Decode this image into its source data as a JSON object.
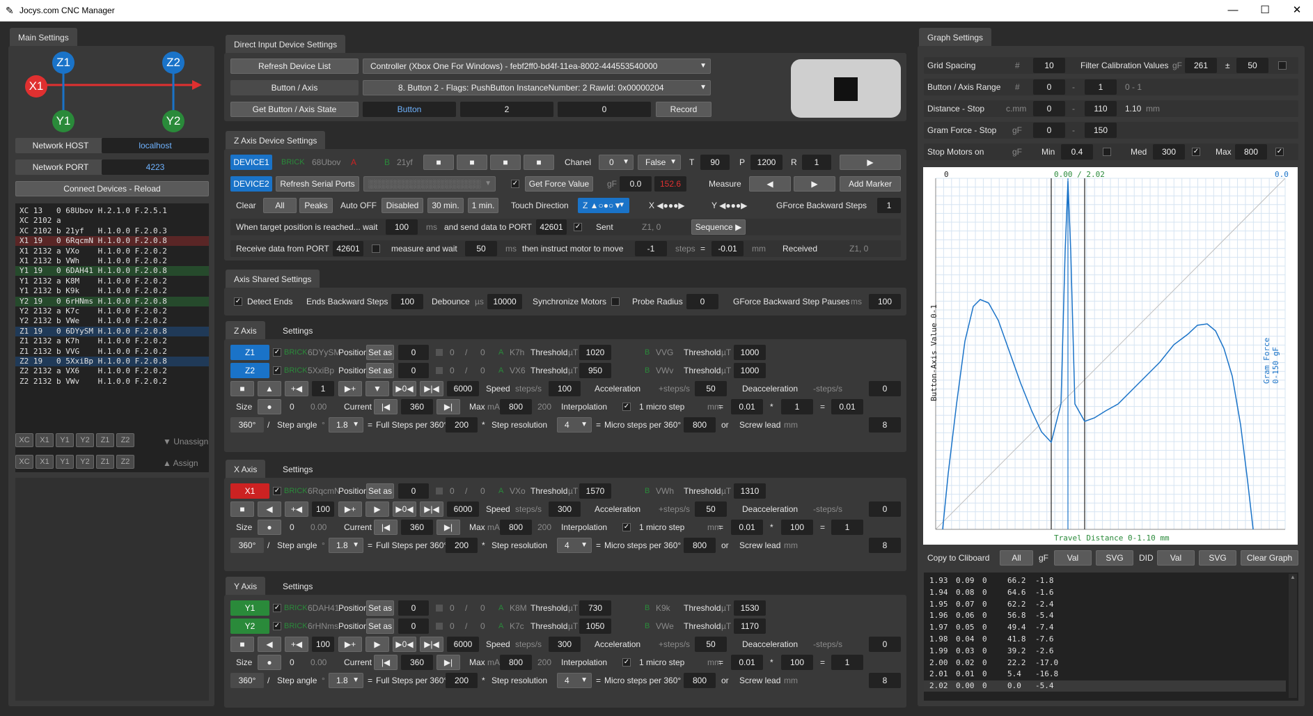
{
  "window": {
    "title": "Jocys.com CNC Manager",
    "icon": "pencil-icon"
  },
  "main_settings": {
    "tab": "Main Settings",
    "axes": {
      "x1": "X1",
      "z1": "Z1",
      "y1": "Y1",
      "z2": "Z2",
      "y2": "Y2"
    },
    "host_label": "Network HOST",
    "host_value": "localhost",
    "port_label": "Network PORT",
    "port_value": "4223",
    "connect": "Connect Devices - Reload",
    "devices": [
      {
        "t": "XC 13   0 68Ubov H.2.1.0 F.2.5.1",
        "c": ""
      },
      {
        "t": "XC 2102 a",
        "c": ""
      },
      {
        "t": "XC 2102 b 21yf   H.1.0.0 F.2.0.3",
        "c": ""
      },
      {
        "t": "X1 19   0 6RqcmN H.1.0.0 F.2.0.8",
        "c": "red"
      },
      {
        "t": "X1 2132 a VXo    H.1.0.0 F.2.0.2",
        "c": ""
      },
      {
        "t": "X1 2132 b VWh    H.1.0.0 F.2.0.2",
        "c": ""
      },
      {
        "t": "Y1 19   0 6DAH41 H.1.0.0 F.2.0.8",
        "c": "green"
      },
      {
        "t": "Y1 2132 a K8M    H.1.0.0 F.2.0.2",
        "c": ""
      },
      {
        "t": "Y1 2132 b K9k    H.1.0.0 F.2.0.2",
        "c": ""
      },
      {
        "t": "Y2 19   0 6rHNms H.1.0.0 F.2.0.8",
        "c": "green"
      },
      {
        "t": "Y2 2132 a K7c    H.1.0.0 F.2.0.2",
        "c": ""
      },
      {
        "t": "Y2 2132 b VWe    H.1.0.0 F.2.0.2",
        "c": ""
      },
      {
        "t": "Z1 19   0 6DYySM H.1.0.0 F.2.0.8",
        "c": "blue"
      },
      {
        "t": "Z1 2132 a K7h    H.1.0.0 F.2.0.2",
        "c": ""
      },
      {
        "t": "Z1 2132 b VVG    H.1.0.0 F.2.0.2",
        "c": ""
      },
      {
        "t": "Z2 19   0 5XxiBp H.1.0.0 F.2.0.8",
        "c": "blue"
      },
      {
        "t": "Z2 2132 a VX6    H.1.0.0 F.2.0.2",
        "c": ""
      },
      {
        "t": "Z2 2132 b VWv    H.1.0.0 F.2.0.2",
        "c": ""
      }
    ],
    "chips": [
      "XC",
      "X1",
      "Y1",
      "Y2",
      "Z1",
      "Z2"
    ],
    "unassign": "Unassign",
    "assign": "Assign"
  },
  "direct_input": {
    "tab": "Direct Input Device Settings",
    "refresh": "Refresh Device List",
    "controller": "Controller (Xbox One For Windows) - febf2ff0-bd4f-11ea-8002-444553540000",
    "button_axis": "Button / Axis",
    "button_desc": "8. Button 2 - Flags: PushButton InstanceNumber: 2 RawId: 0x00000204",
    "get_state": "Get Button / Axis State",
    "state_type": "Button",
    "state_val": "2",
    "state_raw": "0",
    "record": "Record"
  },
  "z_device": {
    "tab": "Z Axis Device Settings",
    "device1": "DEVICE1",
    "brick": "BRICK",
    "d1_id": "68Ubov",
    "a": "A",
    "b": "B",
    "d1_b": "21yf",
    "chanel": "Chanel",
    "chanel_val": "0",
    "false_val": "False",
    "t": "T",
    "t_val": "90",
    "p": "P",
    "p_val": "1200",
    "r": "R",
    "r_val": "1",
    "device2": "DEVICE2",
    "refresh_serial": "Refresh Serial Ports",
    "get_force": "Get Force Value",
    "gf": "gF",
    "force_val": "0.0",
    "force_red": "152.6",
    "measure": "Measure",
    "add_marker": "Add Marker",
    "clear": "Clear",
    "all": "All",
    "peaks": "Peaks",
    "auto_off": "Auto OFF",
    "disabled": "Disabled",
    "m30": "30 min.",
    "m1": "1 min.",
    "touch": "Touch Direction",
    "z_dir": "Z ▲○●○▼",
    "x_dir": "X ◀●●●▶",
    "y_dir": "Y ◀●●●▶",
    "gforce_back": "GForce Backward Steps",
    "gforce_back_val": "1",
    "when_reached": "When target position is reached... wait",
    "wait_val": "100",
    "ms": "ms",
    "send_port": "and send data to PORT",
    "send_port_val": "42601",
    "sent": "Sent",
    "sent_val": "Z1, 0",
    "sequence": "Sequence ▶",
    "recv": "Receive data from PORT",
    "recv_port": "42601",
    "measure_wait": "measure and wait",
    "mw_val": "50",
    "instruct": "then instruct motor to move",
    "move_val": "-1",
    "steps": "steps",
    "eq": "=",
    "mm_val": "-0.01",
    "mm": "mm",
    "received": "Received",
    "received_val": "Z1, 0"
  },
  "shared": {
    "tab": "Axis Shared Settings",
    "detect_ends": "Detect Ends",
    "ends_back": "Ends Backward Steps",
    "ends_back_val": "100",
    "debounce": "Debounce",
    "us": "µs",
    "debounce_val": "10000",
    "sync": "Synchronize Motors",
    "probe": "Probe Radius",
    "probe_val": "0",
    "pauses": "GForce Backward Step Pauses",
    "ms": "ms",
    "pauses_val": "100"
  },
  "common": {
    "settings": "Settings",
    "position": "Position",
    "set_as": "Set as",
    "zero": "0",
    "slash": "/",
    "threshold": "Threshold",
    "ut": "µT",
    "speed": "Speed",
    "steps_s": "steps/s",
    "accel": "Acceleration",
    "accel_u": "+steps/s",
    "deaccel": "Deacceleration",
    "deaccel_u": "-steps/s",
    "size": "Size",
    "current": "Current",
    "max": "Max",
    "ma": "mA",
    "interp": "Interpolation",
    "micro_step": "1 micro step",
    "mm": "mm",
    "star": "*",
    "eq": "=",
    "deg360": "360°",
    "step_angle": "Step angle",
    "deg": "°",
    "full_steps": "Full Steps per 360°",
    "step_res": "Step resolution",
    "micro360": "Micro steps per 360°",
    "or": "or",
    "screw": "Screw lead",
    "zero_dec": "0.00",
    "plus_arrow": "+◀",
    "arrow_plus": "▶+"
  },
  "z_axis": {
    "tab": "Z Axis",
    "m1": "Z1",
    "m1_id": "6DYySM",
    "m1_a": "K7h",
    "m1_ta": "1020",
    "m1_b": "VVG",
    "m1_tb": "1000",
    "m2": "Z2",
    "m2_id": "5XxiBp",
    "m2_a": "VX6",
    "m2_ta": "950",
    "m2_b": "VWv",
    "m2_tb": "1000",
    "step": "1",
    "speed_max": "6000",
    "speed": "100",
    "accel": "50",
    "deaccel": "0",
    "current": "360",
    "max": "800",
    "max_dim": "200",
    "micro_mm": "0.01",
    "mult": "1",
    "result": "0.01",
    "angle": "1.8",
    "full": "200",
    "res": "4",
    "micro": "800",
    "lead": "8"
  },
  "x_axis": {
    "tab": "X Axis",
    "m1": "X1",
    "m1_id": "6RqcmN",
    "m1_a": "VXo",
    "m1_ta": "1570",
    "m1_b": "VWh",
    "m1_tb": "1310",
    "step": "100",
    "speed_max": "6000",
    "speed": "300",
    "accel": "50",
    "deaccel": "0",
    "current": "360",
    "max": "800",
    "max_dim": "200",
    "micro_mm": "0.01",
    "mult": "100",
    "result": "1",
    "angle": "1.8",
    "full": "200",
    "res": "4",
    "micro": "800",
    "lead": "8"
  },
  "y_axis": {
    "tab": "Y Axis",
    "m1": "Y1",
    "m1_id": "6DAH41",
    "m1_a": "K8M",
    "m1_ta": "730",
    "m1_b": "K9k",
    "m1_tb": "1530",
    "m2": "Y2",
    "m2_id": "6rHNms",
    "m2_a": "K7c",
    "m2_ta": "1050",
    "m2_b": "VWe",
    "m2_tb": "1170",
    "step": "100",
    "speed_max": "6000",
    "speed": "300",
    "accel": "50",
    "deaccel": "0",
    "current": "360",
    "max": "800",
    "max_dim": "200",
    "micro_mm": "0.01",
    "mult": "100",
    "result": "1",
    "angle": "1.8",
    "full": "200",
    "res": "4",
    "micro": "800",
    "lead": "8"
  },
  "graph": {
    "tab": "Graph Settings",
    "grid": "Grid Spacing",
    "hash": "#",
    "grid_val": "10",
    "filter": "Filter Calibration Values",
    "gf": "gF",
    "filter_val": "261",
    "pm": "±",
    "filter_pm": "50",
    "range": "Button / Axis Range",
    "range_a": "0",
    "dash": "-",
    "range_b": "1",
    "range_dim": "0 - 1",
    "dist": "Distance - Stop",
    "cmm": "c.mm",
    "dist_a": "0",
    "dist_b": "110",
    "dist_mm": "1.10",
    "mm": "mm",
    "gram": "Gram Force - Stop",
    "gram_a": "0",
    "gram_b": "150",
    "stop": "Stop Motors on",
    "min": "Min",
    "min_val": "0.4",
    "med": "Med",
    "med_val": "300",
    "max": "Max",
    "max_val": "800",
    "copy": "Copy to Cliboard",
    "all": "All",
    "val": "Val",
    "svg": "SVG",
    "did": "DID",
    "clear": "Clear Graph",
    "log": [
      [
        "1.93",
        "0.09",
        "0",
        "66.2",
        "-1.8"
      ],
      [
        "1.94",
        "0.08",
        "0",
        "64.6",
        "-1.6"
      ],
      [
        "1.95",
        "0.07",
        "0",
        "62.2",
        "-2.4"
      ],
      [
        "1.96",
        "0.06",
        "0",
        "56.8",
        "-5.4"
      ],
      [
        "1.97",
        "0.05",
        "0",
        "49.4",
        "-7.4"
      ],
      [
        "1.98",
        "0.04",
        "0",
        "41.8",
        "-7.6"
      ],
      [
        "1.99",
        "0.03",
        "0",
        "39.2",
        "-2.6"
      ],
      [
        "2.00",
        "0.02",
        "0",
        "22.2",
        "-17.0"
      ],
      [
        "2.01",
        "0.01",
        "0",
        "5.4",
        "-16.8"
      ],
      [
        "2.02",
        "0.00",
        "0",
        "0.0",
        "-5.4"
      ]
    ]
  },
  "chart_data": {
    "type": "line",
    "top_left": "0",
    "top_center": "0.00 / 2.02",
    "top_right": "0.0",
    "xlabel": "Travel Distance 0-1.10 mm",
    "ylabel": "Button-Axis Value 0-1",
    "ylabel2": "Gram Force 0-150 gF"
  }
}
